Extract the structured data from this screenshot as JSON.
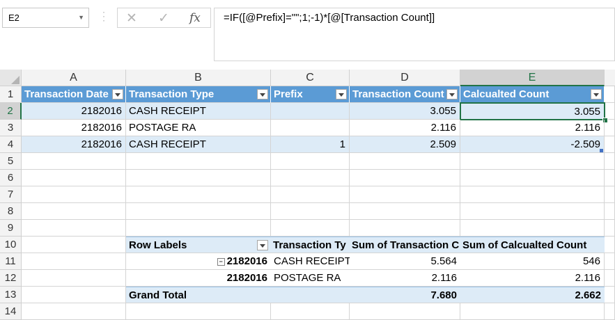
{
  "name_box": "E2",
  "formula": "=IF([@Prefix]=\"\";1;-1)*[@[Transaction Count]]",
  "columns": [
    "A",
    "B",
    "C",
    "D",
    "E"
  ],
  "rows": [
    "1",
    "2",
    "3",
    "4",
    "5",
    "6",
    "7",
    "8",
    "9",
    "10",
    "11",
    "12",
    "13",
    "14"
  ],
  "table": {
    "headers": [
      "Transaction Date",
      "Transaction Type",
      "Prefix",
      "Transaction Count",
      "Calcualted Count"
    ],
    "rows": [
      [
        "2182016",
        "CASH RECEIPT",
        "",
        "3.055",
        "3.055"
      ],
      [
        "2182016",
        "POSTAGE RA",
        "",
        "2.116",
        "2.116"
      ],
      [
        "2182016",
        "CASH RECEIPT",
        "1",
        "2.509",
        "-2.509"
      ]
    ]
  },
  "pivot": {
    "headers": [
      "Row Labels",
      "Transaction Ty",
      "Sum of Transaction C",
      "Sum of Calcualted Count"
    ],
    "rows": [
      [
        "2182016",
        "CASH RECEIPT",
        "5.564",
        "546"
      ],
      [
        "2182016",
        "POSTAGE RA",
        "2.116",
        "2.116"
      ]
    ],
    "total": [
      "Grand Total",
      "7.680",
      "2.662"
    ]
  },
  "colors": {
    "table_header": "#5b9bd5",
    "band": "#ddebf7",
    "selection": "#217346"
  }
}
